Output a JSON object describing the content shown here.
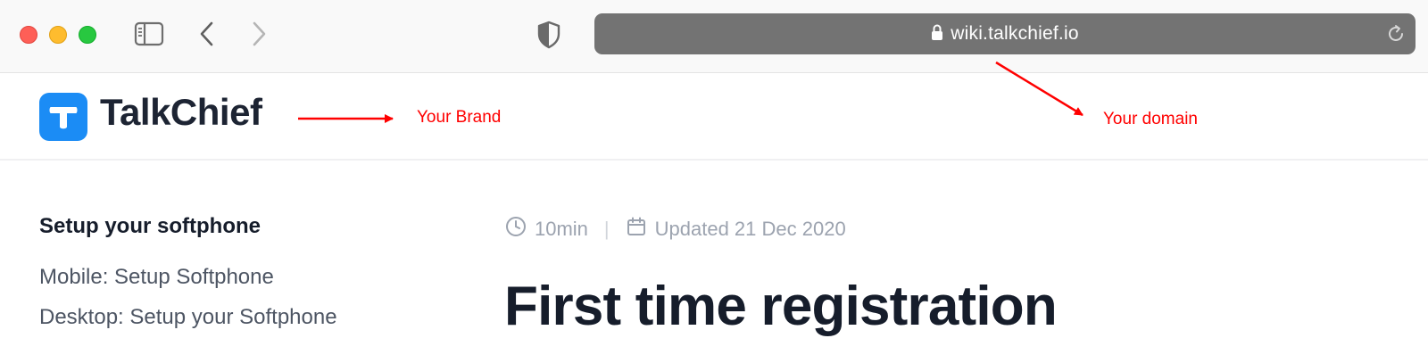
{
  "browser": {
    "url": "wiki.talkchief.io",
    "icons": {
      "sidebar_toggle": "sidebar-toggle-icon",
      "back": "chevron-left-icon",
      "forward": "chevron-right-icon",
      "privacy": "shield-icon",
      "lock": "lock-icon",
      "reload": "reload-icon"
    }
  },
  "header": {
    "brand_name": "TalkChief",
    "brand_color": "#1b8cf5"
  },
  "annotations": {
    "brand_label": "Your Brand",
    "domain_label": "Your domain",
    "color": "#ff0000"
  },
  "sidebar": {
    "heading": "Setup your softphone",
    "links": [
      {
        "label": "Mobile: Setup Softphone"
      },
      {
        "label": "Desktop: Setup your Softphone"
      }
    ]
  },
  "article": {
    "read_time": "10min",
    "updated": "Updated 21 Dec 2020",
    "title": "First time registration"
  }
}
